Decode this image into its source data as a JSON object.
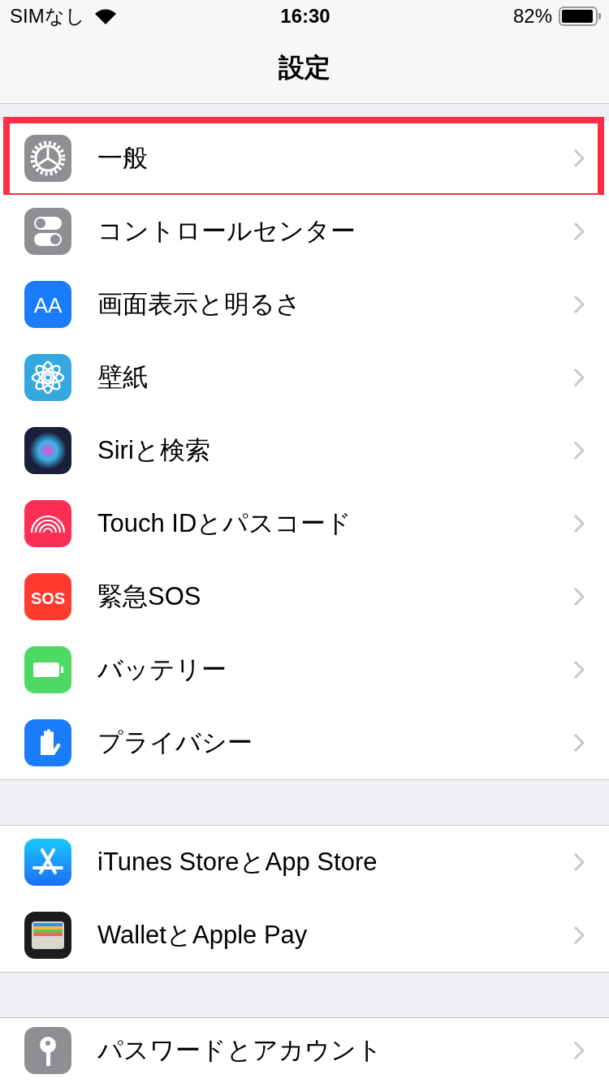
{
  "status_bar": {
    "carrier": "SIMなし",
    "time": "16:30",
    "battery": "82%"
  },
  "nav": {
    "title": "設定"
  },
  "groups": [
    {
      "items": [
        {
          "label": "一般",
          "highlighted": true
        },
        {
          "label": "コントロールセンター",
          "highlighted": false
        },
        {
          "label": "画面表示と明るさ",
          "highlighted": false,
          "icon_text": "AA"
        },
        {
          "label": "壁紙",
          "highlighted": false
        },
        {
          "label": "Siriと検索",
          "highlighted": false
        },
        {
          "label": "Touch IDとパスコード",
          "highlighted": false
        },
        {
          "label": "緊急SOS",
          "highlighted": false,
          "icon_text": "SOS"
        },
        {
          "label": "バッテリー",
          "highlighted": false
        },
        {
          "label": "プライバシー",
          "highlighted": false
        }
      ]
    },
    {
      "items": [
        {
          "label": "iTunes StoreとApp Store",
          "highlighted": false
        },
        {
          "label": "WalletとApple Pay",
          "highlighted": false
        }
      ]
    },
    {
      "items": [
        {
          "label": "パスワードとアカウント",
          "highlighted": false
        }
      ]
    }
  ]
}
